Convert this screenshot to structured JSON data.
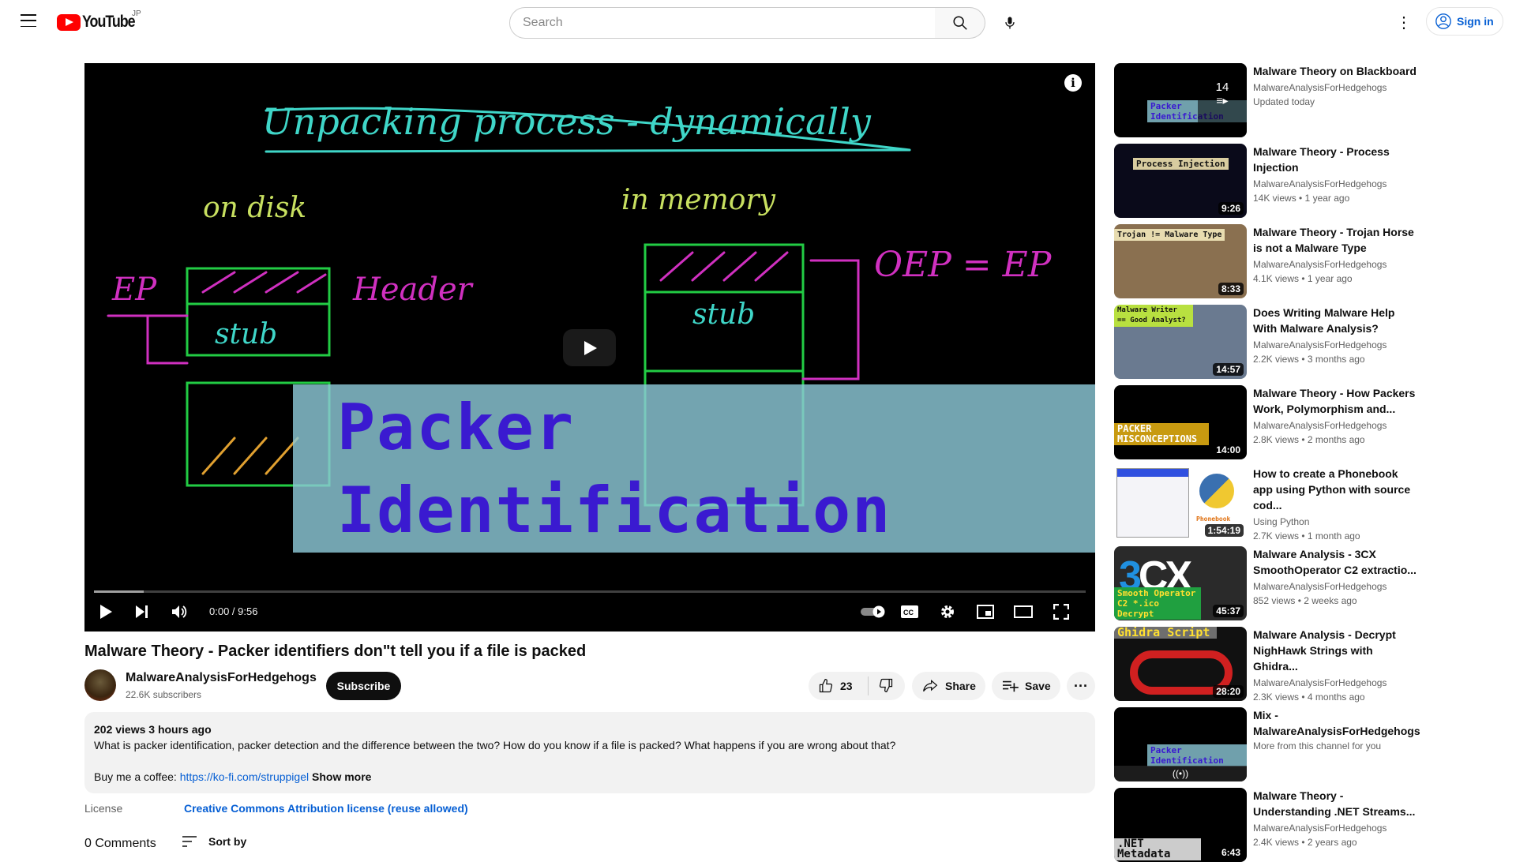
{
  "header": {
    "logo_text": "YouTube",
    "region": "JP",
    "search_placeholder": "Search",
    "signin_label": "Sign in"
  },
  "video": {
    "overlay_line1": "Packer",
    "overlay_line2": "Identification",
    "time": "0:00 / 9:56",
    "progress_loaded_percent": 5,
    "title": "Malware Theory - Packer identifiers don\"t tell you if a file is packed"
  },
  "channel": {
    "name": "MalwareAnalysisForHedgehogs",
    "subscribers": "22.6K subscribers",
    "subscribe_label": "Subscribe"
  },
  "actions": {
    "likes": "23",
    "share": "Share",
    "save": "Save"
  },
  "description": {
    "stats": "202 views  3 hours ago",
    "text": "What is packer identification, packer detection and the difference between the two? How do you know if a file is packed? What happens if you are wrong about that?",
    "coffee_prefix": "Buy me a coffee: ",
    "coffee_link": "https://ko-fi.com/struppigel",
    "show_more": "Show more"
  },
  "license": {
    "label": "License",
    "value": "Creative Commons Attribution license (reuse allowed)"
  },
  "comments": {
    "count": "0 Comments",
    "sort": "Sort by"
  },
  "recommendations": [
    {
      "title": "Malware Theory on Blackboard",
      "channel": "MalwareAnalysisForHedgehogs",
      "meta": "Updated today",
      "badge": "14",
      "thumb_label": "Packer Identification",
      "thumb_bg": "#000000"
    },
    {
      "title": "Malware Theory - Process Injection",
      "channel": "MalwareAnalysisForHedgehogs",
      "meta": "14K views  • 1 year ago",
      "duration": "9:26",
      "thumb_label": "Process Injection",
      "thumb_bg": "#0a0a1a"
    },
    {
      "title": "Malware Theory - Trojan Horse is not a Malware Type",
      "channel": "MalwareAnalysisForHedgehogs",
      "meta": "4.1K views  • 1 year ago",
      "duration": "8:33",
      "thumb_label": "Trojan != Malware Type",
      "thumb_bg": "#8a7050"
    },
    {
      "title": "Does Writing Malware Help With Malware Analysis?",
      "channel": "MalwareAnalysisForHedgehogs",
      "meta": "2.2K views  • 3 months ago",
      "duration": "14:57",
      "thumb_label": "Malware Writer == Good Analyst?",
      "thumb_bg": "#6a7a90"
    },
    {
      "title": "Malware Theory - How Packers Work, Polymorphism and...",
      "channel": "MalwareAnalysisForHedgehogs",
      "meta": "2.8K views  • 2 months ago",
      "duration": "14:00",
      "thumb_label": "PACKER MISCONCEPTIONS",
      "thumb_bg": "#000000"
    },
    {
      "title": "How to create a Phonebook app using Python with source cod...",
      "channel": "Using Python",
      "meta": "2.7K views  • 1 month ago",
      "duration": "1:54:19",
      "thumb_label": "Phonebook",
      "thumb_bg": "#ffffff"
    },
    {
      "title": "Malware Analysis - 3CX SmoothOperator C2 extractio...",
      "channel": "MalwareAnalysisForHedgehogs",
      "meta": "852 views  • 2 weeks ago",
      "duration": "45:37",
      "thumb_label": "Smooth Operator C2 *.ico Decrypt",
      "thumb_bg": "#2a2a2a"
    },
    {
      "title": "Malware Analysis - Decrypt NighHawk Strings with Ghidra...",
      "channel": "MalwareAnalysisForHedgehogs",
      "meta": "2.3K views  • 4 months ago",
      "duration": "28:20",
      "thumb_label": "Ghidra Script",
      "thumb_bg": "#111111"
    },
    {
      "title": "Mix - MalwareAnalysisForHedgehogs",
      "channel": "",
      "meta": "More from this channel for you",
      "thumb_label": "Packer Identification",
      "thumb_bg": "#000000"
    },
    {
      "title": "Malware Theory - Understanding .NET Streams...",
      "channel": "MalwareAnalysisForHedgehogs",
      "meta": "2.4K views  • 2 years ago",
      "duration": "6:43",
      "thumb_label": ".NET Metadata",
      "thumb_bg": "#000000"
    }
  ],
  "colors": {
    "accent": "#ff0000",
    "link": "#065fd4",
    "subscribe_bg": "#0f0f0f",
    "pill_bg": "#f2f2f2"
  }
}
